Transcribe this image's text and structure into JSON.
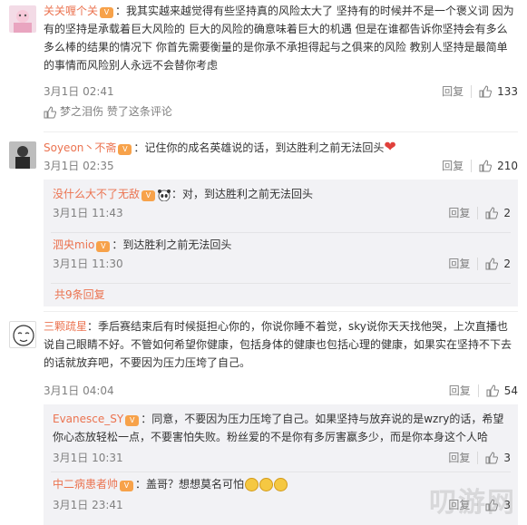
{
  "comments": [
    {
      "user": "关关喱个关",
      "text": "：我其实越来越觉得有些坚持真的风险太大了 坚持有的时候并不是一个褒义词 因为有的坚持是承载着巨大风险的 巨大的风险的确意味着巨大的机遇 但是在谁都告诉你坚持会有多么多么棒的结果的情况下 你首先需要衡量的是你承不承担得起与之俱来的风险 教别人坚持是最简单的事情而风险别人永远不会替你考虑",
      "time": "3月1日 02:41",
      "reply_label": "回复",
      "likes": "133",
      "liked_by": "梦之泪伤 赞了这条评论"
    },
    {
      "user": "Soyeon丶不斋",
      "text": "：记住你的成名英雄说的话，到达胜利之前无法回头",
      "time": "3月1日 02:35",
      "reply_label": "回复",
      "likes": "210",
      "replies": [
        {
          "user": "没什么大不了无敌",
          "text": "：对，到达胜利之前无法回头",
          "time": "3月1日 11:43",
          "reply_label": "回复",
          "likes": "2"
        },
        {
          "user": "泗央mio",
          "text": "：到达胜利之前无法回头",
          "time": "3月1日 11:30",
          "reply_label": "回复",
          "likes": "2"
        }
      ],
      "more_replies": "共9条回复"
    },
    {
      "user": "三颗疏星",
      "text": "：季后赛结束后有时候挺担心你的，你说你睡不着觉，sky说你天天找他哭，上次直播也说自己眼睛不好。不管如何希望你健康，包括身体的健康也包括心理的健康，如果实在坚持不下去的话就放弃吧，不要因为压力压垮了自己。",
      "time": "3月1日 04:04",
      "reply_label": "回复",
      "likes": "54",
      "replies": [
        {
          "user": "Evanesce_SY",
          "text": "：同意，不要因为压力压垮了自己。如果坚持与放弃说的是wzry的话，希望你心态放轻松一点，不要害怕失败。粉丝爱的不是你有多厉害嬴多少，而是你本身这个人哈",
          "time": "3月1日 10:31",
          "reply_label": "回复",
          "likes": "3"
        },
        {
          "user": "中二病患者帅",
          "text": "：盖哥？想想莫名可怕",
          "time": "3月1日 23:41",
          "reply_label": "回复",
          "likes": "3"
        }
      ]
    }
  ],
  "watermark": "叨游网",
  "colors": {
    "username": "#eb7350",
    "meta": "#808080",
    "reply_bg": "#f2f2f5"
  },
  "icons": [
    "vip-badge-icon",
    "thumb-up-icon",
    "heart-icon",
    "emoji-icon",
    "panda-icon"
  ]
}
